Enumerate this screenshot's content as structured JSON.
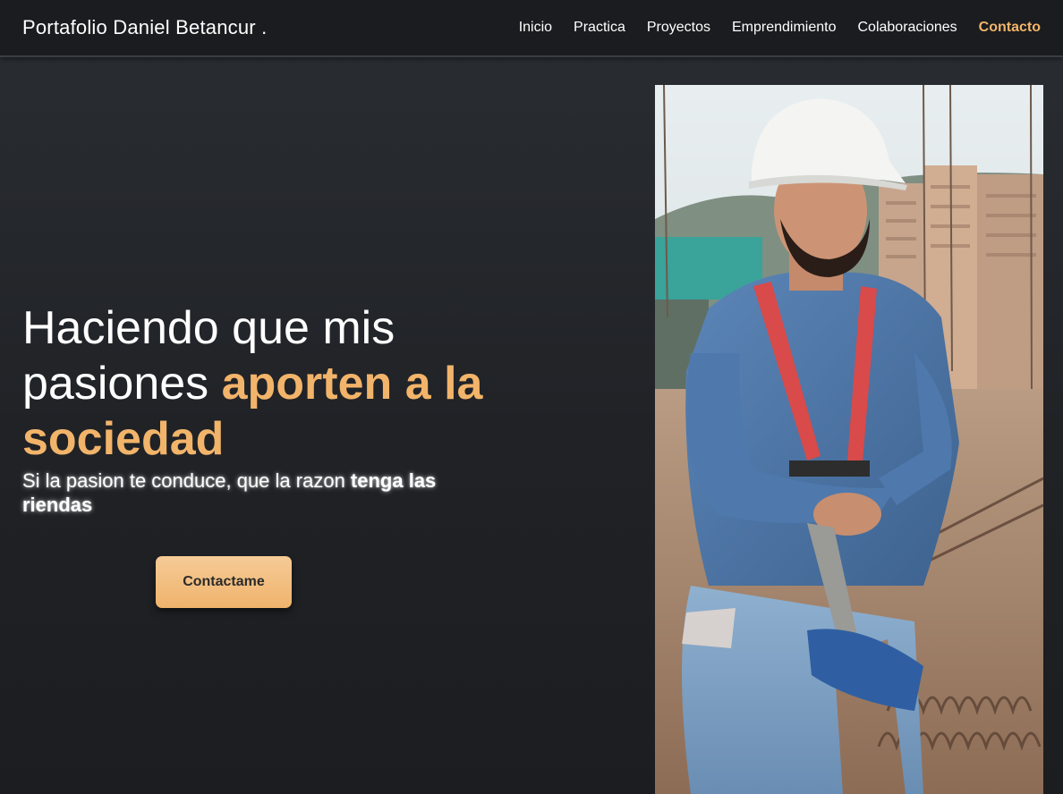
{
  "nav": {
    "brand": "Portafolio Daniel Betancur .",
    "links": [
      "Inicio",
      "Practica",
      "Proyectos",
      "Emprendimiento",
      "Colaboraciones",
      "Contacto"
    ],
    "active": "Contacto"
  },
  "hero": {
    "headline_plain": "Haciendo que mis pasiones ",
    "headline_accent": "aporten a la sociedad",
    "tagline_plain": "Si la pasion te conduce, que la razon ",
    "tagline_bold": "tenga las riendas",
    "cta_label": "Contactame"
  },
  "colors": {
    "accent": "#f2b46a",
    "background": "#202226",
    "navbar": "#1b1c1f",
    "button": "#f0b36c"
  }
}
